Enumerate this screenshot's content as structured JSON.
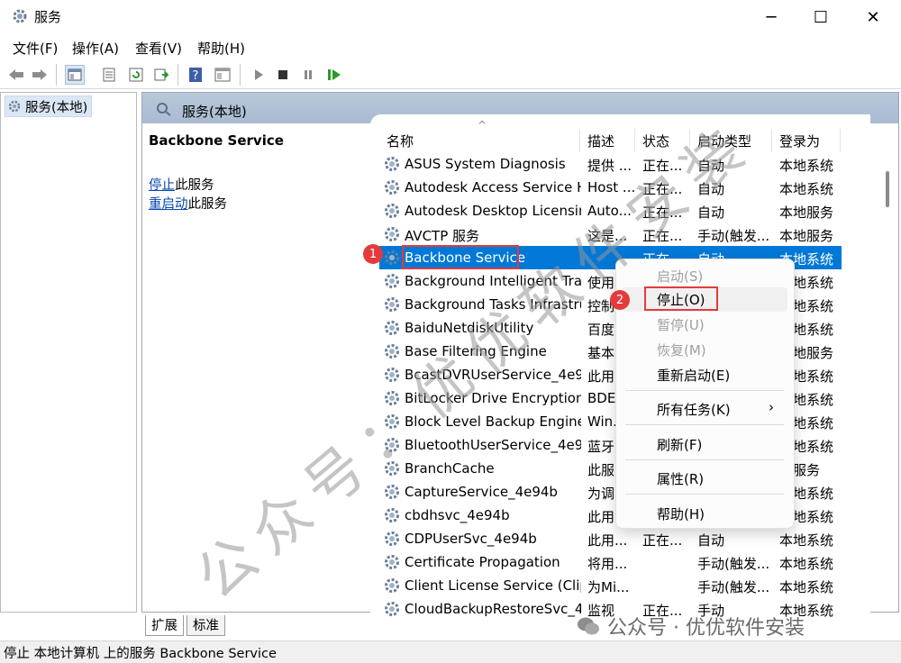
{
  "window": {
    "title": "服务",
    "min": "─",
    "max": "☐",
    "close": "✕"
  },
  "menu": [
    "文件(F)",
    "操作(A)",
    "查看(V)",
    "帮助(H)"
  ],
  "tree": {
    "node": "服务(本地)"
  },
  "panel": {
    "header": "服务(本地)",
    "service_title": "Backbone Service",
    "stop_link": "停止",
    "stop_suffix": "此服务",
    "restart_link": "重启动",
    "restart_suffix": "此服务"
  },
  "columns": {
    "name": "名称",
    "desc": "描述",
    "status": "状态",
    "start": "启动类型",
    "login": "登录为"
  },
  "rows": [
    {
      "name": "ASUS System Diagnosis",
      "desc": "提供 ...",
      "status": "正在...",
      "start": "自动",
      "login": "本地系统"
    },
    {
      "name": "Autodesk Access Service H...",
      "desc": "Host ...",
      "status": "正在...",
      "start": "自动",
      "login": "本地系统"
    },
    {
      "name": "Autodesk Desktop Licensin...",
      "desc": "Auto...",
      "status": "正在...",
      "start": "自动",
      "login": "本地服务"
    },
    {
      "name": "AVCTP 服务",
      "desc": "这是...",
      "status": "正在...",
      "start": "手动(触发...",
      "login": "本地服务"
    },
    {
      "name": "Backbone Service",
      "desc": "",
      "status": "正在...",
      "start": "自动",
      "login": "本地系统"
    },
    {
      "name": "Background Intelligent Tra...",
      "desc": "使用",
      "status": "",
      "start": "",
      "login": "本地系统"
    },
    {
      "name": "Background Tasks Infrastru...",
      "desc": "控制",
      "status": "",
      "start": "",
      "login": "本地系统"
    },
    {
      "name": "BaiduNetdiskUtility",
      "desc": "百度",
      "status": "",
      "start": "",
      "login": "本地系统"
    },
    {
      "name": "Base Filtering Engine",
      "desc": "基本",
      "status": "",
      "start": "",
      "login": "本地服务"
    },
    {
      "name": "BcastDVRUserService_4e9...",
      "desc": "此用",
      "status": "",
      "start": "",
      "login": "本地系统"
    },
    {
      "name": "BitLocker Drive Encryption ...",
      "desc": "BDE...",
      "status": "",
      "start": "",
      "login": "本地系统"
    },
    {
      "name": "Block Level Backup Engine ...",
      "desc": "Win...",
      "status": "",
      "start": "",
      "login": "本地系统"
    },
    {
      "name": "BluetoothUserService_4e9...",
      "desc": "蓝牙",
      "status": "",
      "start": "",
      "login": "本地系统"
    },
    {
      "name": "BranchCache",
      "desc": "此服",
      "status": "",
      "start": "",
      "login": "络服务"
    },
    {
      "name": "CaptureService_4e94b",
      "desc": "为调",
      "status": "",
      "start": "",
      "login": "本地系统"
    },
    {
      "name": "cbdhsvc_4e94b",
      "desc": "此用",
      "status": "",
      "start": "",
      "login": "本地系统"
    },
    {
      "name": "CDPUserSvc_4e94b",
      "desc": "此用...",
      "status": "正在...",
      "start": "自动",
      "login": "本地系统"
    },
    {
      "name": "Certificate Propagation",
      "desc": "将用...",
      "status": "",
      "start": "手动(触发...",
      "login": "本地系统"
    },
    {
      "name": "Client License Service (Clip...",
      "desc": "为Mi...",
      "status": "",
      "start": "手动(触发...",
      "login": "本地系统"
    },
    {
      "name": "CloudBackupRestoreSvc_4...",
      "desc": "监视",
      "status": "正在...",
      "start": "手动",
      "login": "本地系统"
    }
  ],
  "context_menu": {
    "start": "启动(S)",
    "stop": "停止(O)",
    "pause": "暂停(U)",
    "resume": "恢复(M)",
    "restart": "重新启动(E)",
    "all_tasks": "所有任务(K)",
    "refresh": "刷新(F)",
    "properties": "属性(R)",
    "help": "帮助(H)"
  },
  "badges": [
    "1",
    "2"
  ],
  "tabs": [
    "扩展",
    "标准"
  ],
  "status_bar": "停止 本地计算机 上的服务 Backbone Service",
  "watermark": {
    "diagonal": "公众号：优优软件安装",
    "corner": "公众号 · 优优软件安装"
  },
  "colors": {
    "selection": "#0078d7",
    "highlight": "#e23b3b"
  }
}
